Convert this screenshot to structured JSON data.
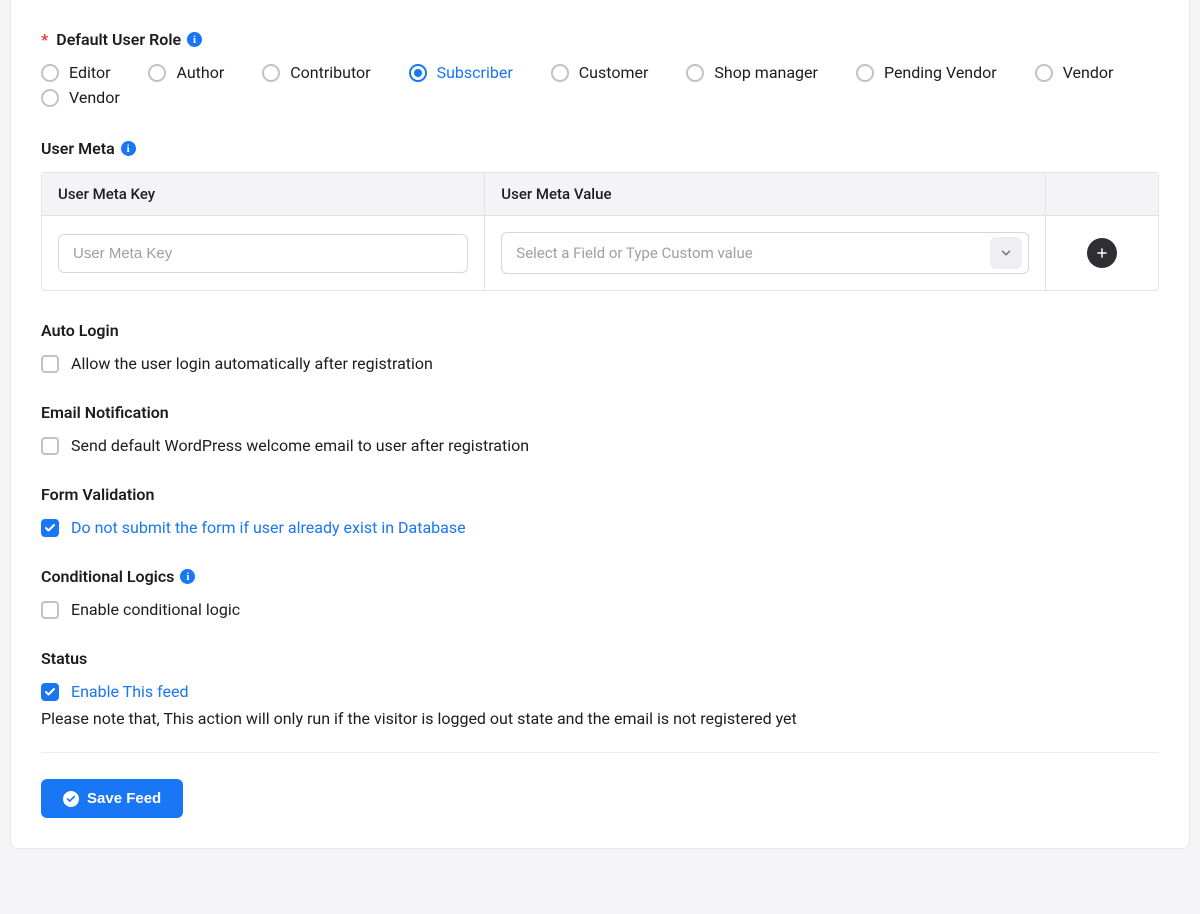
{
  "defaultRole": {
    "label": "Default User Role",
    "options": [
      {
        "key": "editor",
        "label": "Editor",
        "selected": false
      },
      {
        "key": "author",
        "label": "Author",
        "selected": false
      },
      {
        "key": "contributor",
        "label": "Contributor",
        "selected": false
      },
      {
        "key": "subscriber",
        "label": "Subscriber",
        "selected": true
      },
      {
        "key": "customer",
        "label": "Customer",
        "selected": false
      },
      {
        "key": "shop_manager",
        "label": "Shop manager",
        "selected": false
      },
      {
        "key": "pending_vendor",
        "label": "Pending Vendor",
        "selected": false
      },
      {
        "key": "vendor",
        "label": "Vendor",
        "selected": false
      },
      {
        "key": "vendor2",
        "label": "Vendor",
        "selected": false
      }
    ]
  },
  "userMeta": {
    "label": "User Meta",
    "headers": {
      "key": "User Meta Key",
      "value": "User Meta Value"
    },
    "row": {
      "keyPlaceholder": "User Meta Key",
      "valuePlaceholder": "Select a Field or Type Custom value"
    }
  },
  "autoLogin": {
    "label": "Auto Login",
    "checkbox": {
      "label": "Allow the user login automatically after registration",
      "checked": false
    }
  },
  "emailNotification": {
    "label": "Email Notification",
    "checkbox": {
      "label": "Send default WordPress welcome email to user after registration",
      "checked": false
    }
  },
  "formValidation": {
    "label": "Form Validation",
    "checkbox": {
      "label": "Do not submit the form if user already exist in Database",
      "checked": true
    }
  },
  "conditionalLogics": {
    "label": "Conditional Logics",
    "checkbox": {
      "label": "Enable conditional logic",
      "checked": false
    }
  },
  "status": {
    "label": "Status",
    "checkbox": {
      "label": "Enable This feed",
      "checked": true
    },
    "note": "Please note that, This action will only run if the visitor is logged out state and the email is not registered yet"
  },
  "saveButton": {
    "label": "Save Feed"
  }
}
